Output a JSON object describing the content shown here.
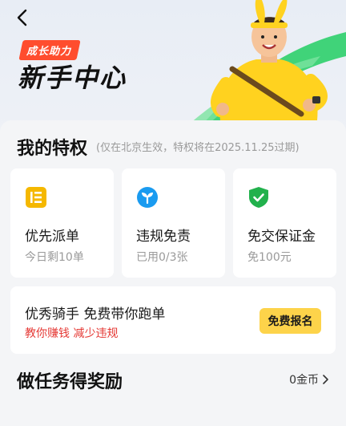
{
  "hero": {
    "tag": "成长助力",
    "title": "新手中心"
  },
  "privileges": {
    "title": "我的特权",
    "note": "(仅在北京生效，特权将在2025.11.25过期)",
    "items": [
      {
        "icon": "list-icon",
        "name": "优先派单",
        "detail": "今日剩10单",
        "color": "#f5b800"
      },
      {
        "icon": "sprout-icon",
        "name": "违规免责",
        "detail": "已用0/3张",
        "color": "#1a9bf0"
      },
      {
        "icon": "shield-check-icon",
        "name": "免交保证金",
        "detail": "免100元",
        "color": "#22b14c"
      }
    ]
  },
  "promo": {
    "headline": "优秀骑手 免费带你跑单",
    "sub": "教你赚钱 减少违规",
    "button": "免费报名"
  },
  "tasks": {
    "title": "做任务得奖励",
    "coins": "0金币"
  }
}
